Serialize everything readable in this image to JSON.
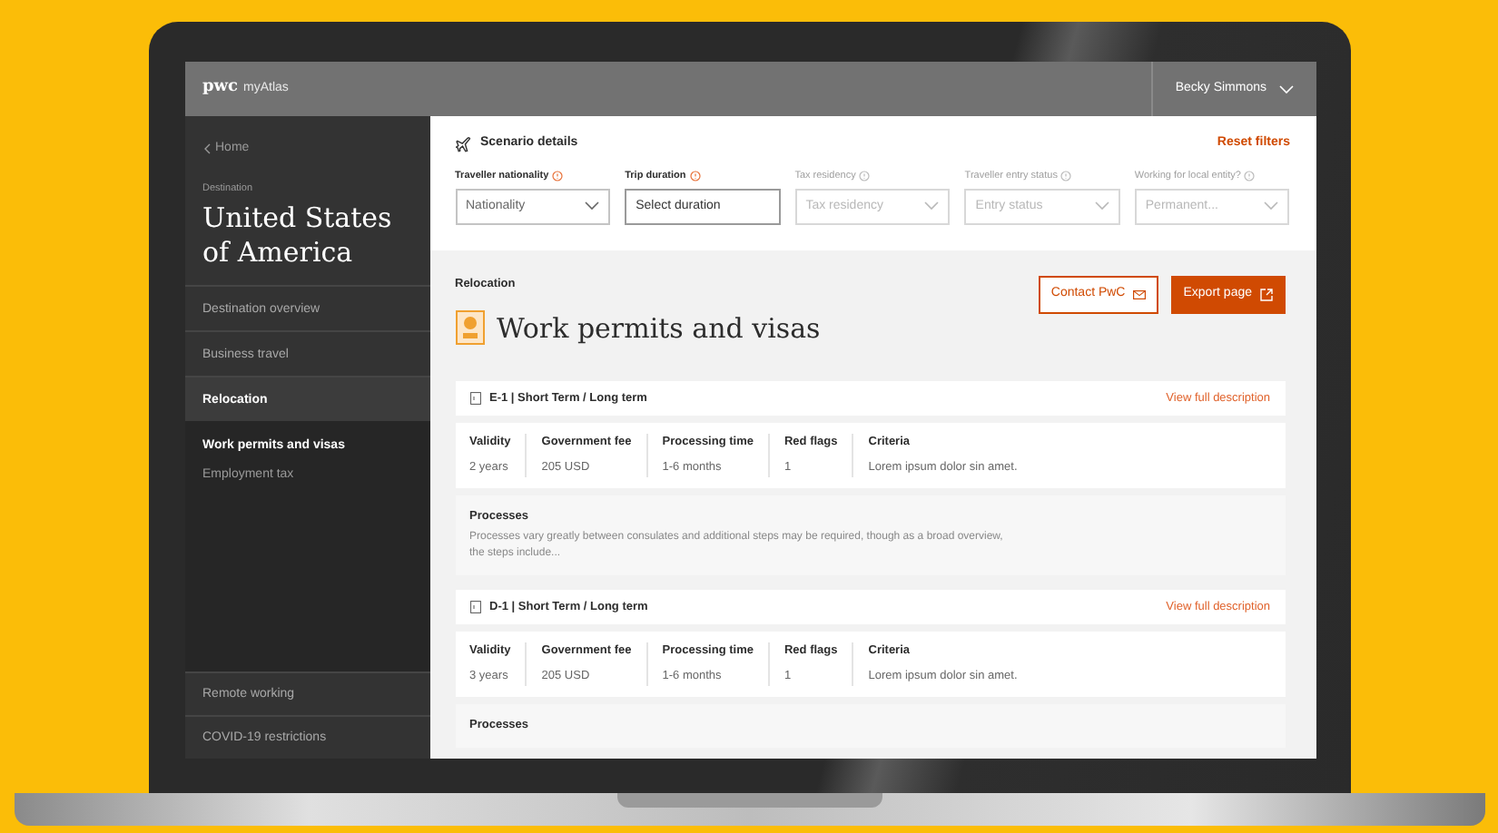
{
  "header": {
    "logo": "pwc",
    "app_name": "myAtlas",
    "user": "Becky Simmons"
  },
  "sidebar": {
    "back": "Home",
    "destination_label": "Destination",
    "destination": "United States of America",
    "items": [
      {
        "label": "Destination overview",
        "selected": false
      },
      {
        "label": "Business travel",
        "selected": false
      },
      {
        "label": "Relocation",
        "selected": true,
        "children": [
          {
            "label": "Work permits and visas",
            "selected": true
          },
          {
            "label": "Employment tax",
            "selected": false
          }
        ]
      }
    ],
    "footer_items": [
      {
        "label": "Remote working",
        "selected": false
      },
      {
        "label": "COVID-19 restrictions",
        "selected": false
      }
    ]
  },
  "scenario": {
    "title": "Scenario details",
    "reset": "Reset filters",
    "filters": [
      {
        "label": "Traveller nationality",
        "placeholder": "Nationality",
        "kind": "select",
        "disabled": false
      },
      {
        "label": "Trip duration",
        "placeholder": "Select duration",
        "kind": "text",
        "disabled": false
      },
      {
        "label": "Tax residency",
        "placeholder": "Tax residency",
        "kind": "select",
        "disabled": true
      },
      {
        "label": "Traveller entry status",
        "placeholder": "Entry status",
        "kind": "select",
        "disabled": true
      },
      {
        "label": "Working for local entity?",
        "placeholder": "Permanent...",
        "kind": "select",
        "disabled": true
      }
    ]
  },
  "section": {
    "category": "Relocation",
    "title": "Work permits and visas",
    "buttons": [
      {
        "label": "Contact PwC",
        "kind": "outline"
      },
      {
        "label": "Export page",
        "kind": "primary"
      }
    ]
  },
  "visas": [
    {
      "title": "E-1 | Short Term / Long term",
      "link": "View full description",
      "facts": [
        {
          "label": "Validity",
          "value": "2 years"
        },
        {
          "label": "Government fee",
          "value": "205 USD"
        },
        {
          "label": "Processing time",
          "value": "1-6 months"
        },
        {
          "label": "Red flags",
          "value": "1"
        },
        {
          "label": "Criteria",
          "value": "Lorem ipsum dolor sin amet."
        }
      ],
      "processes_label": "Processes",
      "processes_text": "Processes vary greatly between consulates and additional steps may be required, though as a broad overview, the steps include..."
    },
    {
      "title": "D-1 | Short Term / Long term",
      "link": "View full description",
      "facts": [
        {
          "label": "Validity",
          "value": "3 years"
        },
        {
          "label": "Government fee",
          "value": "205 USD"
        },
        {
          "label": "Processing time",
          "value": "1-6 months"
        },
        {
          "label": "Red flags",
          "value": "1"
        },
        {
          "label": "Criteria",
          "value": "Lorem ipsum dolor sin amet."
        }
      ],
      "processes_label": "Processes"
    }
  ]
}
